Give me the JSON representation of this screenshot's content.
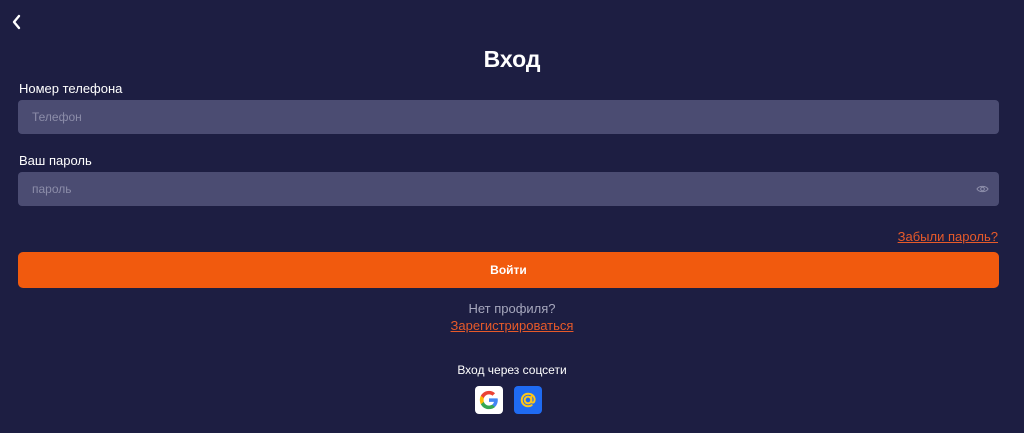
{
  "header": {
    "back_icon": "chevron-left-icon",
    "title": "Вход"
  },
  "form": {
    "phone": {
      "label": "Номер телефона",
      "placeholder": "Телефон",
      "value": ""
    },
    "password": {
      "label": "Ваш пароль",
      "placeholder": "пароль",
      "value": "",
      "toggle_icon": "eye-icon"
    },
    "forgot_label": "Забыли пароль?",
    "submit_label": "Войти"
  },
  "register": {
    "prompt": "Нет профиля?",
    "link_label": "Зарегистрироваться"
  },
  "social": {
    "label": "Вход через соцсети",
    "providers": [
      {
        "icon": "google-icon"
      },
      {
        "icon": "mail-at-icon"
      }
    ]
  },
  "colors": {
    "background": "#1d1e42",
    "input": "#4b4c72",
    "accent": "#f15a0e",
    "link": "#e75a2a"
  }
}
